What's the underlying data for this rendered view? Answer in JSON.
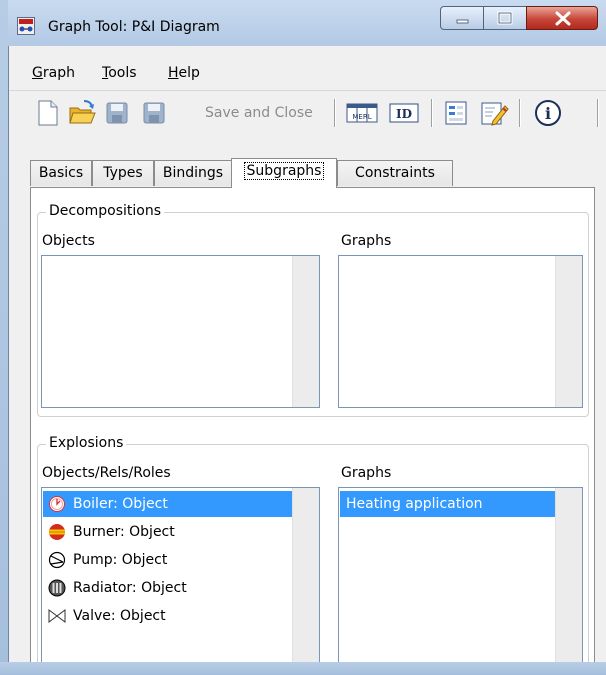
{
  "window": {
    "title": "Graph Tool: P&I Diagram"
  },
  "menu": [
    {
      "label": "Graph",
      "mnemonic": "G",
      "rest": "raph"
    },
    {
      "label": "Tools",
      "mnemonic": "T",
      "rest": "ools"
    },
    {
      "label": "Help",
      "mnemonic": "H",
      "rest": "elp"
    }
  ],
  "toolbar": {
    "save_close_label": "Save and Close",
    "mergeable_label": "MERL",
    "id_label": "ID",
    "info_label": "i"
  },
  "tabs": [
    {
      "label": "Basics",
      "active": false
    },
    {
      "label": "Types",
      "active": false
    },
    {
      "label": "Bindings",
      "active": false
    },
    {
      "label": "Subgraphs",
      "active": true
    },
    {
      "label": "Constraints",
      "active": false
    }
  ],
  "decompositions": {
    "title": "Decompositions",
    "objects_label": "Objects",
    "graphs_label": "Graphs"
  },
  "explosions": {
    "title": "Explosions",
    "objects_label": "Objects/Rels/Roles",
    "graphs_label": "Graphs",
    "objects": [
      {
        "label": "Boiler: Object",
        "icon": "boiler-icon",
        "selected": true
      },
      {
        "label": "Burner: Object",
        "icon": "burner-icon",
        "selected": false
      },
      {
        "label": "Pump: Object",
        "icon": "pump-icon",
        "selected": false
      },
      {
        "label": "Radiator: Object",
        "icon": "radiator-icon",
        "selected": false
      },
      {
        "label": "Valve: Object",
        "icon": "valve-icon",
        "selected": false
      }
    ],
    "graphs": [
      {
        "label": "Heating application",
        "selected": true
      }
    ]
  },
  "colors": {
    "selection": "#3399ff",
    "close_button": "#c7463a",
    "frame": "#bfd3ea"
  }
}
